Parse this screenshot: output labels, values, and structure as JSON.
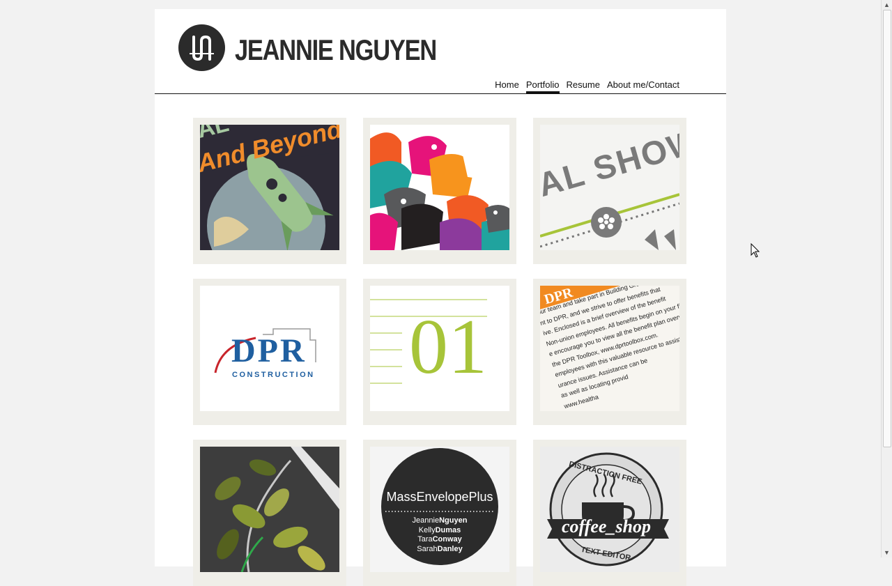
{
  "header": {
    "site_title": "JEANNIE NGUYEN",
    "logo_icon": "jn-monogram-logo"
  },
  "nav": {
    "items": [
      {
        "label": "Home",
        "active": false
      },
      {
        "label": "Portfolio",
        "active": true
      },
      {
        "label": "Resume",
        "active": false
      },
      {
        "label": "About me/Contact",
        "active": false
      }
    ]
  },
  "portfolio": {
    "tiles": [
      {
        "subject": "rocket-poster",
        "text_a": "And Beyond",
        "text_b": "AL"
      },
      {
        "subject": "python-logo-pattern"
      },
      {
        "subject": "art-show-flyer",
        "text_a": "AL SHOW"
      },
      {
        "subject": "dpr-construction-logo",
        "text_a": "DPR",
        "text_b": "CONSTRUCTION"
      },
      {
        "subject": "number-01-design",
        "text_a": "01"
      },
      {
        "subject": "dpr-benefits-letter",
        "text_a": "DPR",
        "lines": [
          "our team and take part in Building Great",
          "nt to DPR, and we strive to offer benefits that",
          "ive.  Enclosed is a brief overview of the benefit",
          "Non-union employees. All benefits begin on your first",
          "e encourage you to view all the benefit plan overviews",
          "the DPR Toolbox, www.dprtoolbox.com.",
          "employees with this valuable resource to assist",
          "urance issues. Assistance can be",
          "as well as locating provid",
          "www.healtha"
        ]
      },
      {
        "subject": "leaf-illustration"
      },
      {
        "subject": "mass-envelope-plus",
        "text_a": "MassEnvelopePlus",
        "names": [
          {
            "first": "Jeannie",
            "last": "Nguyen"
          },
          {
            "first": "Kelly",
            "last": "Dumas"
          },
          {
            "first": "Tara",
            "last": "Conway"
          },
          {
            "first": "Sarah",
            "last": "Danley"
          }
        ]
      },
      {
        "subject": "coffee-shop-badge",
        "text_a": "DISTRACTION FREE",
        "text_b": "coffee_shop",
        "text_c": "TEXT EDITOR"
      }
    ]
  },
  "colors": {
    "tile_bg": "#efeee8",
    "lime": "#a7c439",
    "dpr_blue": "#1f5fa0",
    "dpr_red": "#c8242b",
    "orange": "#f18a21"
  }
}
